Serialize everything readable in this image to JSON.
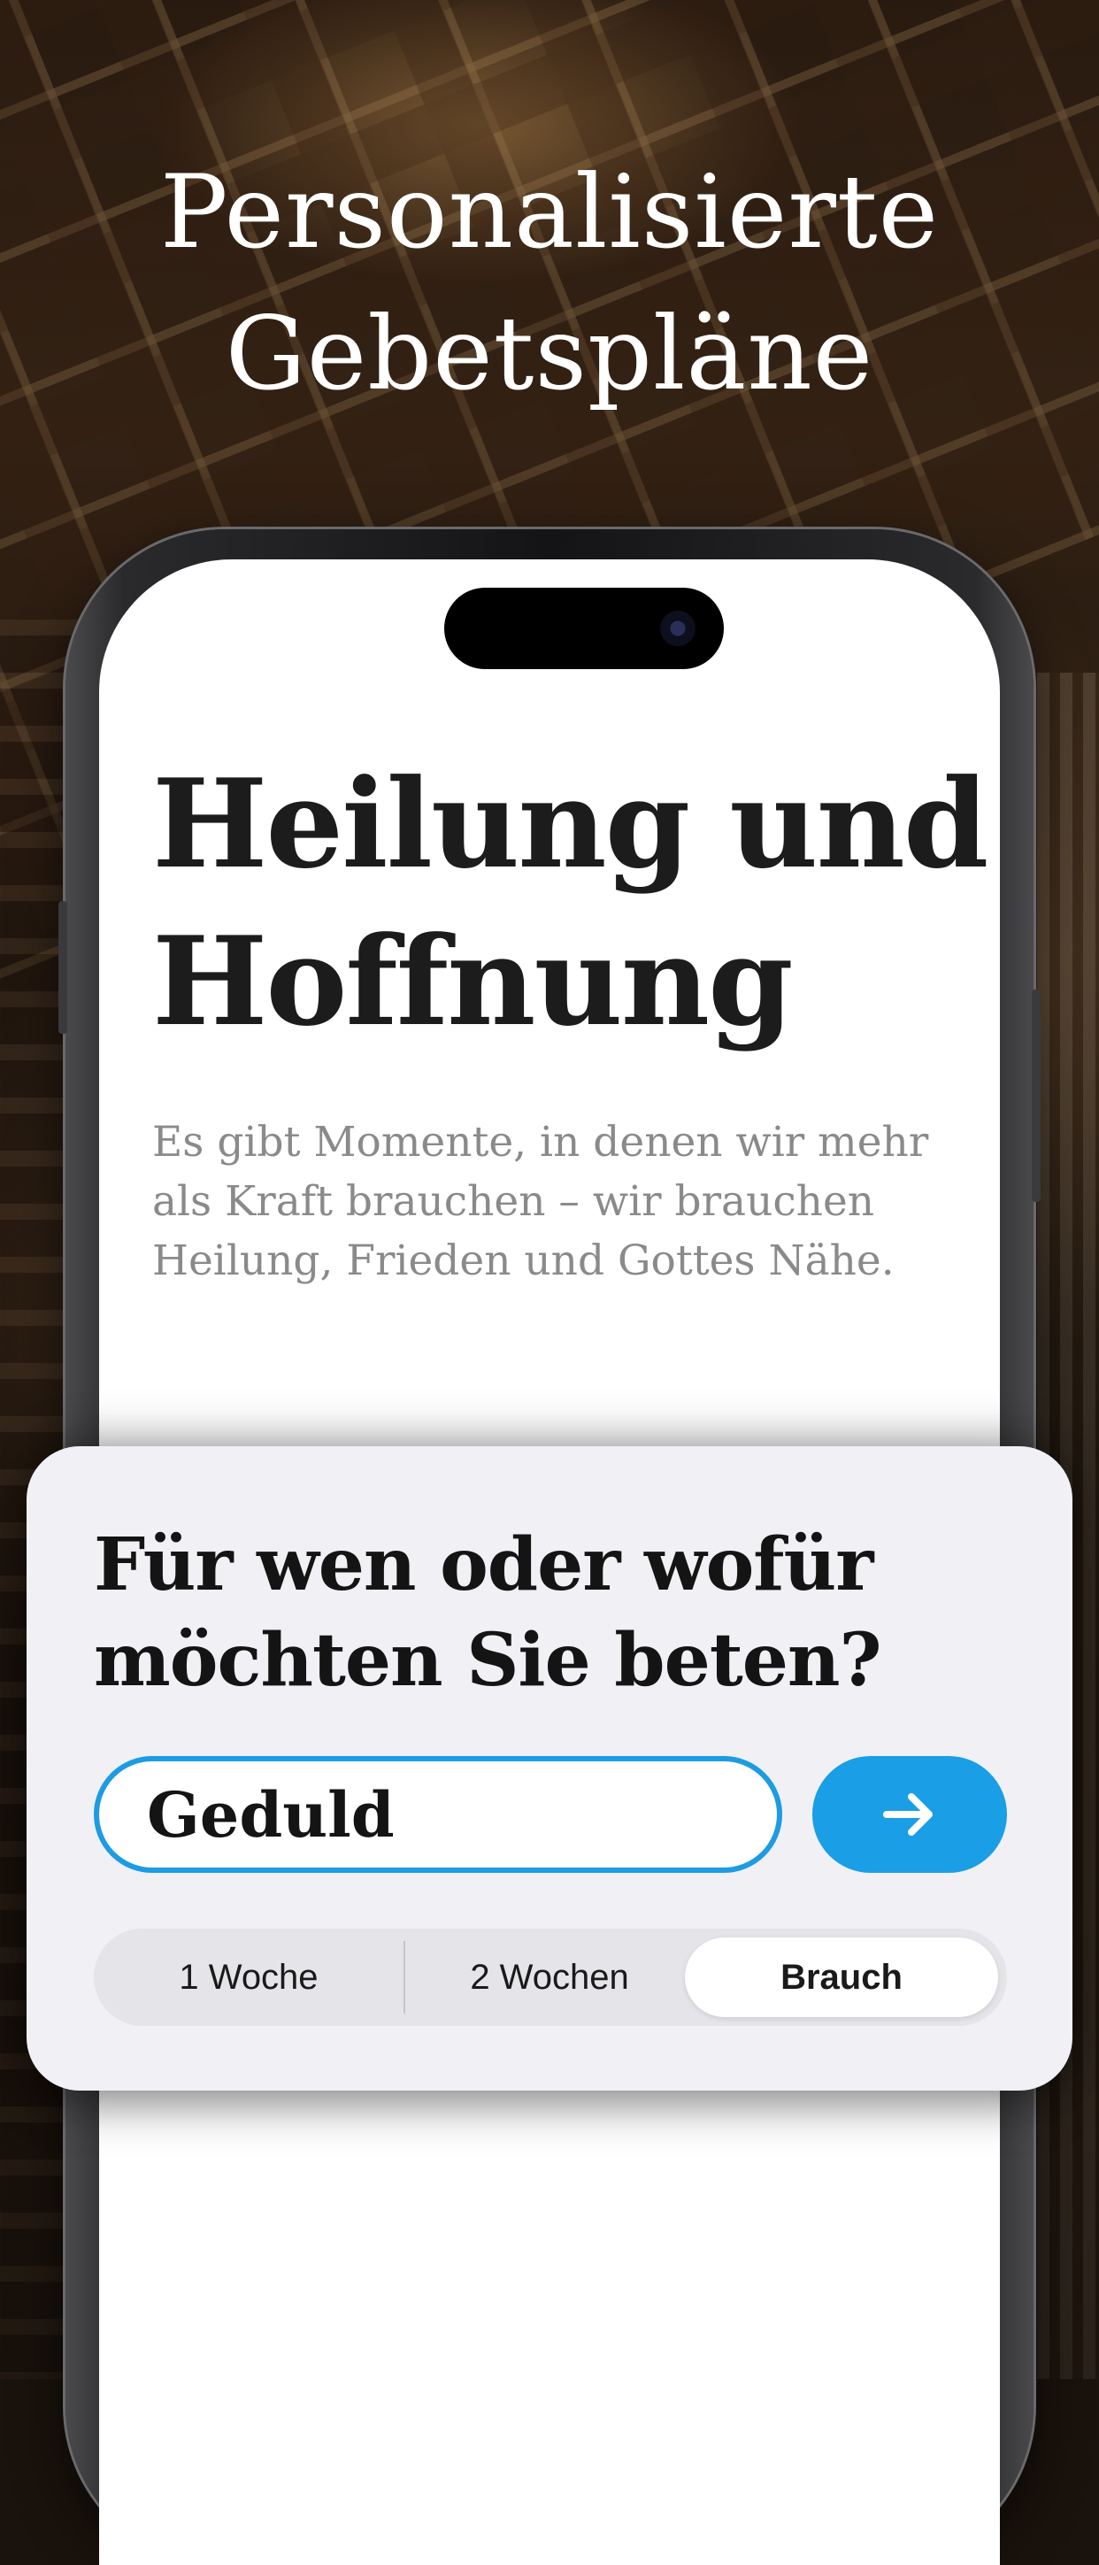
{
  "headline": {
    "line1": "Personalisierte",
    "line2": "Gebetspläne"
  },
  "screen": {
    "title_line1": "Heilung und",
    "title_line2": "Hoffnung",
    "description": "Es gibt Momente, in denen wir mehr als Kraft brauchen – wir brauchen Heilung, Frieden und Gottes Nähe."
  },
  "card": {
    "question_line1": "Für wen oder wofür",
    "question_line2": "möchten Sie beten?",
    "input_value": "Geduld",
    "submit_icon": "arrow-right-icon",
    "duration_options": [
      "1 Woche",
      "2 Wochen",
      "Brauch"
    ],
    "selected_option": "Brauch"
  },
  "colors": {
    "accent": "#1a9ee6",
    "input_border": "#1d9be3",
    "card_background": "#f1f0f5",
    "title_text": "#1c1c1c",
    "description_text": "#8a8a8a"
  }
}
